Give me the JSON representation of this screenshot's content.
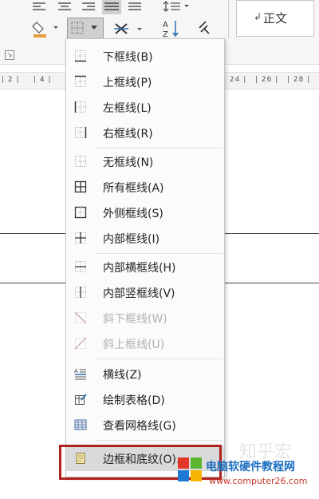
{
  "ribbon": {
    "style_label": "正文",
    "style_mark": "↲",
    "ruler_left": [
      "| 2 |",
      "| 4 |"
    ],
    "ruler_right": [
      "| 24 |",
      "| 26 |",
      "| 28 |"
    ]
  },
  "menu": {
    "items": [
      {
        "label": "下框线(B)",
        "icon": "bottom-border-icon",
        "disabled": false
      },
      {
        "label": "上框线(P)",
        "icon": "top-border-icon",
        "disabled": false
      },
      {
        "label": "左框线(L)",
        "icon": "left-border-icon",
        "disabled": false
      },
      {
        "label": "右框线(R)",
        "icon": "right-border-icon",
        "disabled": false
      },
      {
        "label": "无框线(N)",
        "icon": "no-border-icon",
        "disabled": false
      },
      {
        "label": "所有框线(A)",
        "icon": "all-borders-icon",
        "disabled": false
      },
      {
        "label": "外侧框线(S)",
        "icon": "outside-borders-icon",
        "disabled": false
      },
      {
        "label": "内部框线(I)",
        "icon": "inside-borders-icon",
        "disabled": false
      },
      {
        "label": "内部横框线(H)",
        "icon": "inside-horizontal-border-icon",
        "disabled": false
      },
      {
        "label": "内部竖框线(V)",
        "icon": "inside-vertical-border-icon",
        "disabled": false
      },
      {
        "label": "斜下框线(W)",
        "icon": "diagonal-down-border-icon",
        "disabled": true
      },
      {
        "label": "斜上框线(U)",
        "icon": "diagonal-up-border-icon",
        "disabled": true
      },
      {
        "label": "横线(Z)",
        "icon": "horizontal-line-icon",
        "disabled": false
      },
      {
        "label": "绘制表格(D)",
        "icon": "draw-table-icon",
        "disabled": false
      },
      {
        "label": "查看网格线(G)",
        "icon": "view-gridlines-icon",
        "disabled": false
      },
      {
        "label": "边框和底纹(O)...",
        "icon": "borders-shading-icon",
        "disabled": false
      }
    ]
  },
  "watermark": {
    "title": "电脑软硬件教程网",
    "url": "www.computer26.com",
    "faint": "知乎宏"
  },
  "colors": {
    "highlight": "#b0221d",
    "brand_blue": "#1d6fc0"
  }
}
